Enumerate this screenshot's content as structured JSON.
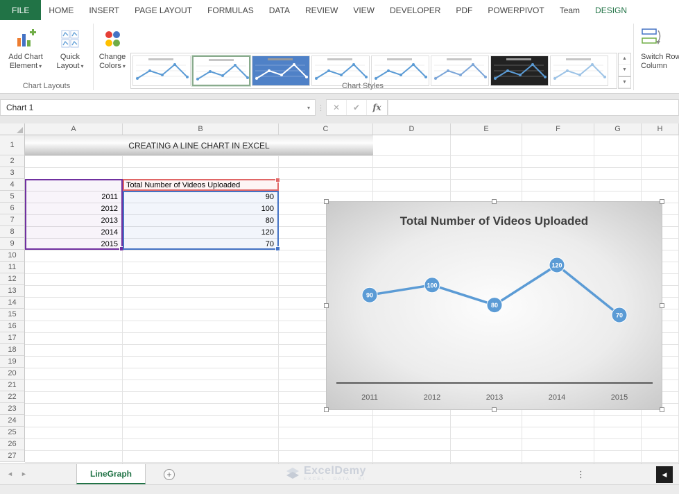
{
  "window": {
    "tabs": [
      "FILE",
      "HOME",
      "INSERT",
      "PAGE LAYOUT",
      "FORMULAS",
      "DATA",
      "REVIEW",
      "VIEW",
      "DEVELOPER",
      "PDF",
      "POWERPIVOT",
      "Team",
      "DESIGN"
    ]
  },
  "icons": {
    "caret_down": "▾",
    "cancel": "✕",
    "enter": "✔",
    "nav_prev": "◄",
    "nav_next": "►",
    "scroll_left": "◀",
    "kebab": "⋮",
    "new_sheet": "+",
    "gallery_up": "▲",
    "gallery_down": "▼",
    "gallery_more": "▼"
  },
  "ribbon": {
    "add_chart_element": {
      "line1": "Add Chart",
      "line2": "Element"
    },
    "quick_layout": {
      "line1": "Quick",
      "line2": "Layout"
    },
    "change_colors": {
      "line1": "Change",
      "line2": "Colors"
    },
    "switch_row_column": {
      "line1": "Switch Row/",
      "line2": "Column"
    },
    "group_labels": {
      "chart_layouts": "Chart Layouts",
      "chart_styles": "Chart Styles"
    },
    "gallery": [
      {
        "name": "chart-style-1",
        "bg": "#ffffff",
        "line": "#5b9bd5",
        "selected": false,
        "dark": false
      },
      {
        "name": "chart-style-2",
        "bg": "#ffffff",
        "line": "#5b9bd5",
        "selected": true,
        "dark": false
      },
      {
        "name": "chart-style-3",
        "bg": "#4f81c7",
        "line": "#ffffff",
        "selected": false,
        "dark": true
      },
      {
        "name": "chart-style-4",
        "bg": "#ffffff",
        "line": "#5b9bd5",
        "selected": false,
        "dark": false
      },
      {
        "name": "chart-style-5",
        "bg": "#ffffff",
        "line": "#5b9bd5",
        "selected": false,
        "dark": false
      },
      {
        "name": "chart-style-6",
        "bg": "#ffffff",
        "line": "#7ca6d8",
        "selected": false,
        "dark": false
      },
      {
        "name": "chart-style-7",
        "bg": "#222222",
        "line": "#5b9bd5",
        "selected": false,
        "dark": true
      },
      {
        "name": "chart-style-8",
        "bg": "#ffffff",
        "line": "#9dc3e6",
        "selected": false,
        "dark": false
      }
    ]
  },
  "formula_bar": {
    "name_box": "Chart 1",
    "fx_label": "fx",
    "formula_value": ""
  },
  "grid": {
    "columns": [
      "A",
      "B",
      "C",
      "D",
      "E",
      "F",
      "G",
      "H"
    ],
    "rows": [
      1,
      2,
      3,
      4,
      5,
      6,
      7,
      8,
      9,
      10,
      11,
      12,
      13,
      14,
      15,
      16,
      17,
      18,
      19,
      20,
      21,
      22,
      23,
      24,
      25,
      26,
      27
    ]
  },
  "sheet": {
    "title": "CREATING A LINE CHART IN EXCEL",
    "series_header": "Total Number of Videos Uploaded",
    "data": [
      {
        "year": "2011",
        "value": "90"
      },
      {
        "year": "2012",
        "value": "100"
      },
      {
        "year": "2013",
        "value": "80"
      },
      {
        "year": "2014",
        "value": "120"
      },
      {
        "year": "2015",
        "value": "70"
      }
    ]
  },
  "chart_data": {
    "type": "line",
    "title": "Total Number of Videos Uploaded",
    "categories": [
      "2011",
      "2012",
      "2013",
      "2014",
      "2015"
    ],
    "values": [
      90,
      100,
      80,
      120,
      70
    ],
    "series": [
      {
        "name": "Total Number of Videos Uploaded",
        "values": [
          90,
          100,
          80,
          120,
          70
        ]
      }
    ],
    "data_labels": true,
    "legend": "none",
    "line_color": "#5b9bd5",
    "label_color": "#ffffff",
    "axis_color": "#595959",
    "title_color": "#3f3f3f"
  },
  "bottom": {
    "sheet_tab": "LineGraph",
    "watermark": "ExcelDemy",
    "watermark_tagline": "EXCEL · DATA · BI"
  },
  "colors": {
    "accent_green": "#217346",
    "series_blue": "#5b9bd5",
    "range_purple": "#7030a0",
    "range_blue": "#4472c4",
    "range_red": "#e06666"
  }
}
